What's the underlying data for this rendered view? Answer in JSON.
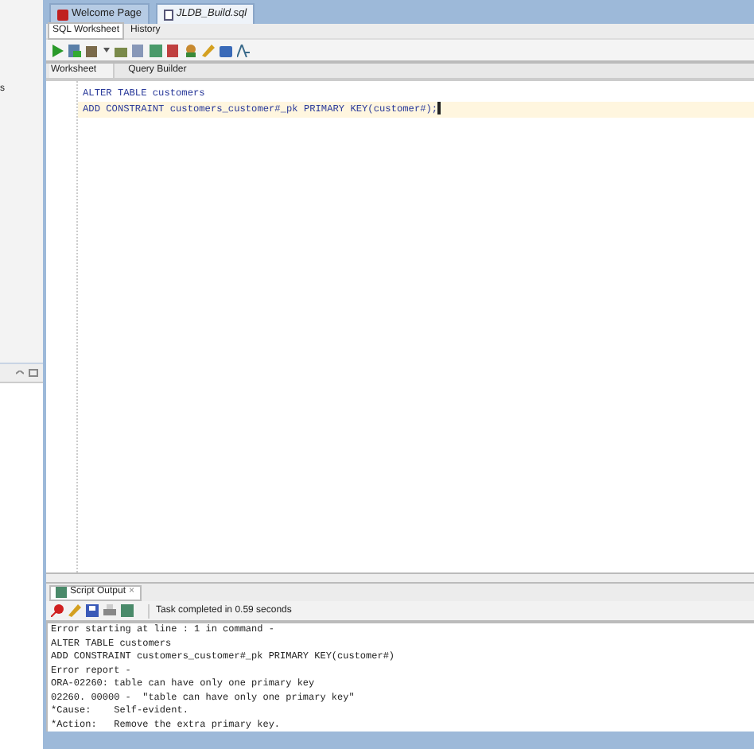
{
  "window_tabs": [
    {
      "label": "Welcome Page",
      "selected": false
    },
    {
      "label": "JLDB_Build.sql",
      "selected": true
    }
  ],
  "left_panel": {
    "text": "s"
  },
  "worksheet_tabs": [
    {
      "label": "SQL Worksheet",
      "selected": true
    },
    {
      "label": "History",
      "selected": false
    }
  ],
  "editor_tabs": [
    {
      "label": "Worksheet",
      "selected": true
    },
    {
      "label": "Query Builder",
      "selected": false
    }
  ],
  "editor_lines": [
    {
      "text": "ALTER TABLE customers",
      "current": false
    },
    {
      "text": "ADD CONSTRAINT customers_customer#_pk PRIMARY KEY(customer#);",
      "current": true
    }
  ],
  "output": {
    "tab": "Script Output",
    "close": "×",
    "status": "Task completed in 0.59 seconds",
    "lines": [
      "Error starting at line : 1 in command -",
      "ALTER TABLE customers",
      "ADD CONSTRAINT customers_customer#_pk PRIMARY KEY(customer#)",
      "Error report -",
      "ORA-02260: table can have only one primary key",
      "02260. 00000 -  \"table can have only one primary key\"",
      "*Cause:    Self-evident.",
      "*Action:   Remove the extra primary key."
    ]
  }
}
